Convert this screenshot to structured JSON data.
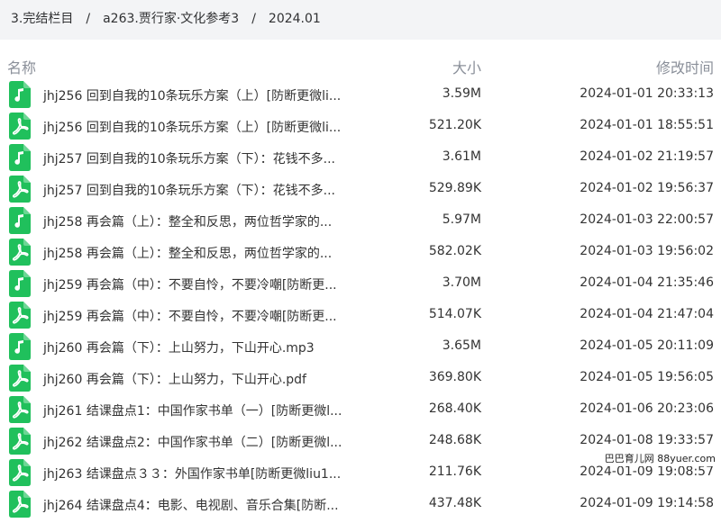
{
  "breadcrumb": {
    "items": [
      "3.完结栏目",
      "a263.贾行家·文化参考3",
      "2024.01"
    ],
    "separator": "/"
  },
  "columns": {
    "name": "名称",
    "size": "大小",
    "modified": "修改时间"
  },
  "colors": {
    "icon_green": "#20c05c",
    "header_text": "#8a8f99",
    "breadcrumb_bg": "#f3f4f6"
  },
  "files": [
    {
      "name": "jhj256 回到自我的10条玩乐方案（上）[防断更微li...",
      "size": "3.59M",
      "modified": "2024-01-01 20:33:13",
      "icon": "music-file-icon"
    },
    {
      "name": "jhj256 回到自我的10条玩乐方案（上）[防断更微li...",
      "size": "521.20K",
      "modified": "2024-01-01 18:55:51",
      "icon": "pdf-file-icon"
    },
    {
      "name": "jhj257 回到自我的10条玩乐方案（下）：花钱不多...",
      "size": "3.61M",
      "modified": "2024-01-02 21:19:57",
      "icon": "music-file-icon"
    },
    {
      "name": "jhj257 回到自我的10条玩乐方案（下）：花钱不多...",
      "size": "529.89K",
      "modified": "2024-01-02 19:56:37",
      "icon": "pdf-file-icon"
    },
    {
      "name": "jhj258 再会篇（上）：整全和反思，两位哲学家的...",
      "size": "5.97M",
      "modified": "2024-01-03 22:00:57",
      "icon": "music-file-icon"
    },
    {
      "name": "jhj258 再会篇（上）：整全和反思，两位哲学家的...",
      "size": "582.02K",
      "modified": "2024-01-03 19:56:02",
      "icon": "pdf-file-icon"
    },
    {
      "name": "jhj259 再会篇（中）：不要自怜，不要冷嘲[防断更...",
      "size": "3.70M",
      "modified": "2024-01-04 21:35:46",
      "icon": "music-file-icon"
    },
    {
      "name": "jhj259 再会篇（中）：不要自怜，不要冷嘲[防断更...",
      "size": "514.07K",
      "modified": "2024-01-04 21:47:04",
      "icon": "pdf-file-icon"
    },
    {
      "name": "jhj260 再会篇（下）：上山努力，下山开心.mp3",
      "size": "3.65M",
      "modified": "2024-01-05 20:11:09",
      "icon": "music-file-icon"
    },
    {
      "name": "jhj260 再会篇（下）：上山努力，下山开心.pdf",
      "size": "369.80K",
      "modified": "2024-01-05 19:56:05",
      "icon": "pdf-file-icon"
    },
    {
      "name": "jhj261 结课盘点1：中国作家书单（一）[防断更微l...",
      "size": "268.40K",
      "modified": "2024-01-06 20:23:06",
      "icon": "pdf-file-icon"
    },
    {
      "name": "jhj262 结课盘点2：中国作家书单（二）[防断更微l...",
      "size": "248.68K",
      "modified": "2024-01-08 19:33:57",
      "icon": "pdf-file-icon"
    },
    {
      "name": "jhj263 结课盘点３３：外国作家书单[防断更微liu1...",
      "size": "211.76K",
      "modified": "2024-01-09 19:08:57",
      "icon": "pdf-file-icon"
    },
    {
      "name": "jhj264 结课盘点4：电影、电视剧、音乐合集[防断...",
      "size": "437.48K",
      "modified": "2024-01-09 19:14:58",
      "icon": "pdf-file-icon"
    }
  ],
  "watermark": "巴巴育儿网 88yuer.com"
}
